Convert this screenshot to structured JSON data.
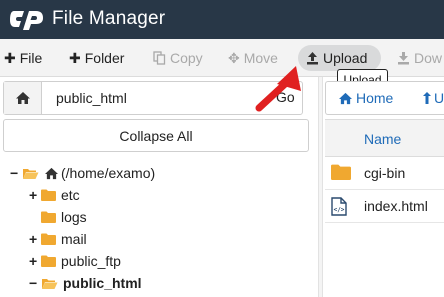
{
  "header": {
    "logo_icon": "cpanel-logo",
    "title": "File Manager",
    "background": "#283747"
  },
  "toolbar": {
    "items": [
      {
        "label": "File",
        "icon": "plus-icon",
        "enabled": true
      },
      {
        "label": "Folder",
        "icon": "plus-icon",
        "enabled": true
      },
      {
        "label": "Copy",
        "icon": "copy-icon",
        "enabled": false
      },
      {
        "label": "Move",
        "icon": "move-icon",
        "enabled": false
      },
      {
        "label": "Upload",
        "icon": "upload-icon",
        "enabled": true,
        "highlighted": true
      },
      {
        "label": "Dow",
        "icon": "download-icon",
        "enabled": false
      }
    ],
    "tooltip": "Upload"
  },
  "left_panel": {
    "home_icon": "home-icon",
    "path_value": "public_html",
    "go_label": "Go",
    "collapse_label": "Collapse All",
    "tree": [
      {
        "label": "(/home/examo)",
        "toggle": "−",
        "icon": "open-folder-home-icon",
        "bold": false
      },
      {
        "label": "etc",
        "toggle": "+",
        "icon": "folder-icon",
        "bold": false
      },
      {
        "label": "logs",
        "toggle": "",
        "icon": "folder-icon",
        "bold": false
      },
      {
        "label": "mail",
        "toggle": "+",
        "icon": "folder-icon",
        "bold": false
      },
      {
        "label": "public_ftp",
        "toggle": "+",
        "icon": "folder-icon",
        "bold": false
      },
      {
        "label": "public_html",
        "toggle": "−",
        "icon": "open-folder-icon",
        "bold": true
      }
    ]
  },
  "right_panel": {
    "home_label": "Home",
    "up_label": "U",
    "column_name": "Name",
    "files": [
      {
        "name": "cgi-bin",
        "icon": "folder-icon"
      },
      {
        "name": "index.html",
        "icon": "html-file-icon"
      }
    ]
  },
  "colors": {
    "accent_link": "#1f6bb8",
    "folder": "#f0a830",
    "arrow": "#e02020"
  }
}
